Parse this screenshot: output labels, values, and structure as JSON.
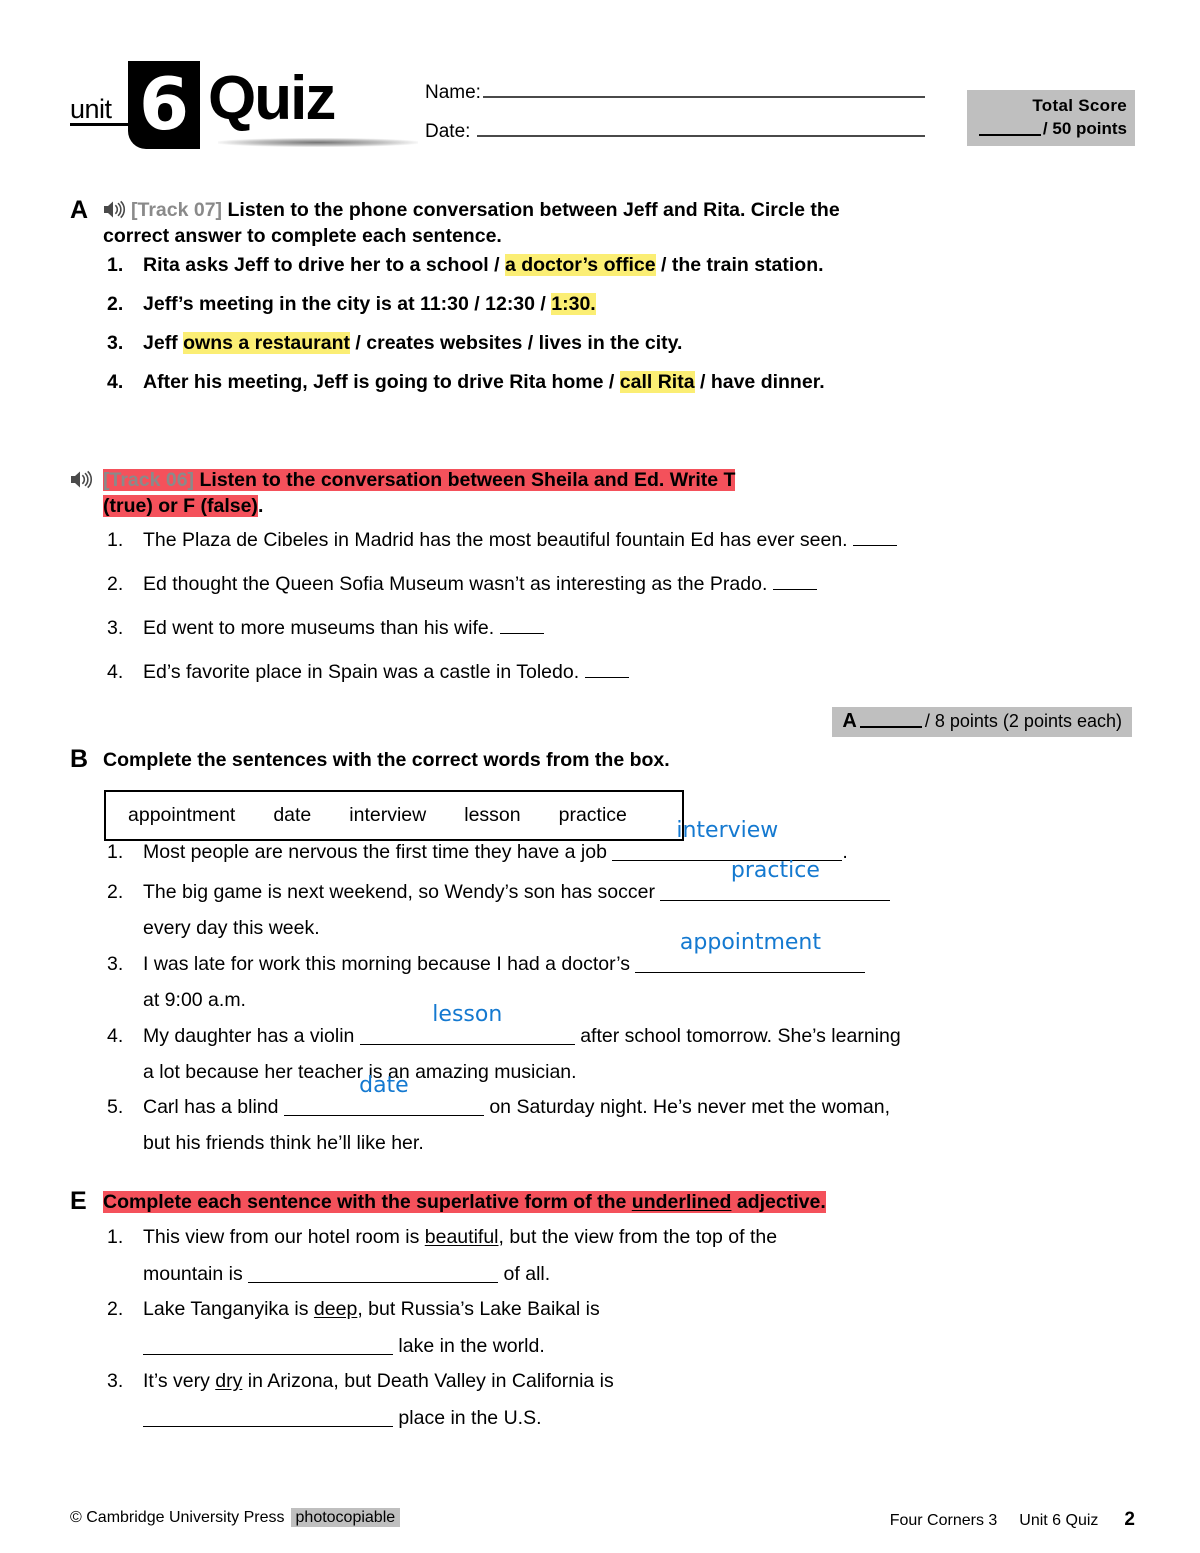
{
  "header": {
    "unit_label": "unit",
    "unit_number": "6",
    "quiz_label": "Quiz",
    "name_label": "Name:",
    "date_label": "Date:",
    "score": {
      "title": "Total Score",
      "points_text": "/ 50 points"
    }
  },
  "section_a": {
    "letter": "A",
    "icon": "speaker-icon",
    "track": "[Track 07]",
    "instruction": "Listen to the phone conversation between Jeff and Rita. Circle the correct answer to complete each sentence.",
    "items": [
      {
        "num": "1.",
        "lead": "Rita asks Jeff to drive her to ",
        "opt1": "a school",
        "sep1": " / ",
        "opt2": "a doctor’s office",
        "sep2": " / ",
        "opt3": "the train station.",
        "highlight": 2
      },
      {
        "num": "2.",
        "lead": "Jeff’s meeting in the city is at ",
        "opt1": "11:30",
        "sep1": " / ",
        "opt2": "12:30",
        "sep2": " / ",
        "opt3": "1:30.",
        "highlight": 3
      },
      {
        "num": "3.",
        "lead": "Jeff ",
        "opt1": "owns a restaurant",
        "sep1": " / ",
        "opt2": "creates websites",
        "sep2": " / ",
        "opt3": "lives in the city.",
        "highlight": 1
      },
      {
        "num": "4.",
        "lead": "After his meeting, Jeff is going to ",
        "opt1": "drive Rita home",
        "sep1": " / ",
        "opt2": "call Rita",
        "sep2": " / ",
        "opt3": "have dinner.",
        "highlight": 2
      }
    ]
  },
  "section_a2": {
    "icon": "speaker-icon",
    "track": "[Track 06]",
    "instruction_line1": "Listen to the conversation between Sheila and Ed. Write T",
    "instruction_line2": "(true) or F (false)",
    "instruction_tail": ".",
    "items": [
      {
        "num": "1.",
        "text": "The Plaza de Cibeles in Madrid has the most beautiful fountain Ed has ever seen."
      },
      {
        "num": "2.",
        "text": "Ed thought the Queen Sofia Museum wasn’t as interesting as the Prado."
      },
      {
        "num": "3.",
        "text": "Ed went to more museums than his wife."
      },
      {
        "num": "4.",
        "text": "Ed’s favorite place in Spain was a castle in Toledo."
      }
    ]
  },
  "points_bar_a": {
    "letter": "A",
    "text": "/ 8 points (2 points each)"
  },
  "section_b": {
    "letter": "B",
    "instruction": "Complete the sentences with the correct words from the box.",
    "wordbank": [
      "appointment",
      "date",
      "interview",
      "lesson",
      "practice"
    ],
    "items": [
      {
        "num": "1.",
        "before": "Most people are nervous the first time they have a job ",
        "answer": "interview",
        "after": ".",
        "cont": ""
      },
      {
        "num": "2.",
        "before": "The big game is next weekend, so Wendy’s son has soccer ",
        "answer": "practice",
        "after": "",
        "cont": "every day this week."
      },
      {
        "num": "3.",
        "before": "I was late for work this morning because I had a doctor’s ",
        "answer": "appointment",
        "after": "",
        "cont": "at 9:00 a.m."
      },
      {
        "num": "4.",
        "before": "My daughter has a violin ",
        "answer": "lesson",
        "after": " after school tomorrow. She’s learning",
        "cont": "a lot because her teacher is an amazing musician."
      },
      {
        "num": "5.",
        "before": "Carl has a blind ",
        "answer": "date",
        "after": " on Saturday night. He’s never met the woman,",
        "cont": "but his friends think he’ll like her."
      }
    ]
  },
  "section_e": {
    "letter": "E",
    "instruction_pre": "Complete each sentence with the superlative form of the ",
    "instruction_underlined": "underlined",
    "instruction_post": " adjective.",
    "items": [
      {
        "num": "1.",
        "pre": "This view from our hotel room is ",
        "adj": "beautiful",
        "post": ", but the view from the top of the",
        "line2_pre": "mountain is ",
        "line2_post": " of all."
      },
      {
        "num": "2.",
        "pre": "Lake Tanganyika is ",
        "adj": "deep",
        "post": ", but Russia’s Lake Baikal is",
        "line2_pre": "",
        "line2_post": " lake in the world."
      },
      {
        "num": "3.",
        "pre": "It’s very ",
        "adj": "dry",
        "post": " in Arizona, but Death Valley in California is",
        "line2_pre": "",
        "line2_post": " place in the U.S."
      }
    ]
  },
  "footer": {
    "copyright": "© Cambridge University Press",
    "photocopiable": "photocopiable",
    "book": "Four Corners 3",
    "unit": "Unit 6 Quiz",
    "page": "2"
  },
  "colors": {
    "highlight_yellow": "#fbee74",
    "highlight_red": "#f4515b",
    "answer_blue": "#1479d0",
    "box_gray": "#bfbfbf",
    "track_gray": "#8a8a8a"
  }
}
